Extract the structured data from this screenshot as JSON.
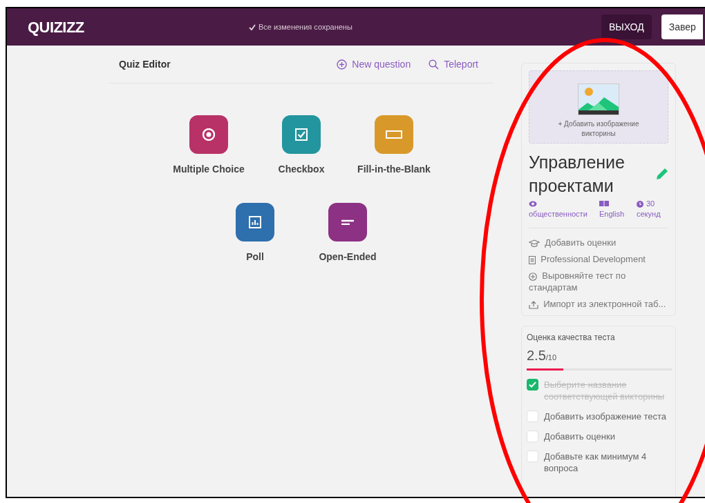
{
  "header": {
    "logo": "QUIZIZZ",
    "save_status": "Все изменения сохранены",
    "buttons": [
      {
        "kind": "exit",
        "label": "ВЫХОД"
      },
      {
        "kind": "finish",
        "label": "Завер"
      }
    ]
  },
  "editor": {
    "title": "Quiz Editor",
    "actions": [
      {
        "kind": "new",
        "label": "New question"
      },
      {
        "kind": "teleport",
        "label": "Teleport"
      }
    ]
  },
  "question_types": [
    {
      "kind": "multiple",
      "label": "Multiple Choice",
      "color": "#b83267"
    },
    {
      "kind": "checkbox",
      "label": "Checkbox",
      "color": "#23959e"
    },
    {
      "kind": "blank",
      "label": "Fill-in-the-Blank",
      "color": "#d9992a"
    },
    {
      "kind": "poll",
      "label": "Poll",
      "color": "#2e6fad"
    },
    {
      "kind": "open",
      "label": "Open-Ended",
      "color": "#8c3183"
    }
  ],
  "quiz_card": {
    "add_image": "+ Добавить изображение викторины",
    "title": "Управление проектами",
    "meta": [
      {
        "kind": "visibility",
        "label": "общественности"
      },
      {
        "kind": "language",
        "label": "English"
      },
      {
        "kind": "timer",
        "label": "30 секунд"
      }
    ],
    "links": [
      {
        "kind": "grade",
        "label": "Добавить оценки"
      },
      {
        "kind": "subject",
        "label": "Professional Development"
      },
      {
        "kind": "standards",
        "label": "Выровняйте тест по стандартам"
      },
      {
        "kind": "import",
        "label": "Импорт из электронной таб..."
      }
    ]
  },
  "quality": {
    "title": "Оценка качества теста",
    "score": "2.5",
    "max": "/10",
    "level": 0.25,
    "checklist": [
      {
        "label": "Выберите название соответствующей викторины",
        "checked": true
      },
      {
        "label": "Добавить изображение теста",
        "checked": false
      },
      {
        "label": "Добавить оценки",
        "checked": false
      },
      {
        "label": "Добавьте как минимум 4 вопроса",
        "checked": false
      }
    ]
  }
}
